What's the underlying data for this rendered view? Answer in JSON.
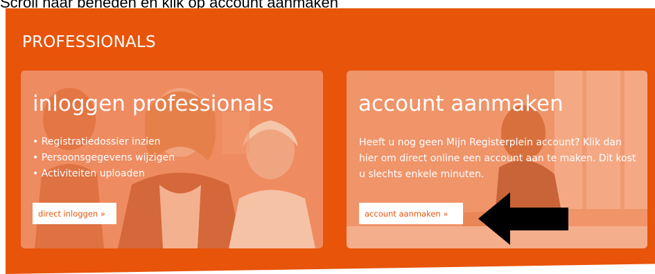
{
  "instruction": "Scroll naar beneden en klik op account aanmaken",
  "section": {
    "title": "PROFESSIONALS"
  },
  "cards": {
    "login": {
      "title": "inloggen professionals",
      "bullets": [
        "• Registratiedossier inzien",
        "• Persoonsgegevens wijzigen",
        "• Activiteiten uploaden"
      ],
      "button_label": "direct inloggen »"
    },
    "register": {
      "title": "account aanmaken",
      "text": "Heeft u nog geen Mijn Registerplein account? Klik dan hier om direct online een account aan te maken. Dit kost u slechts enkele minuten.",
      "button_label": "account aanmaken »"
    }
  },
  "colors": {
    "brand_orange": "#e8540a",
    "white": "#ffffff"
  },
  "icons": {
    "annotation_arrow": "left-arrow-icon"
  }
}
